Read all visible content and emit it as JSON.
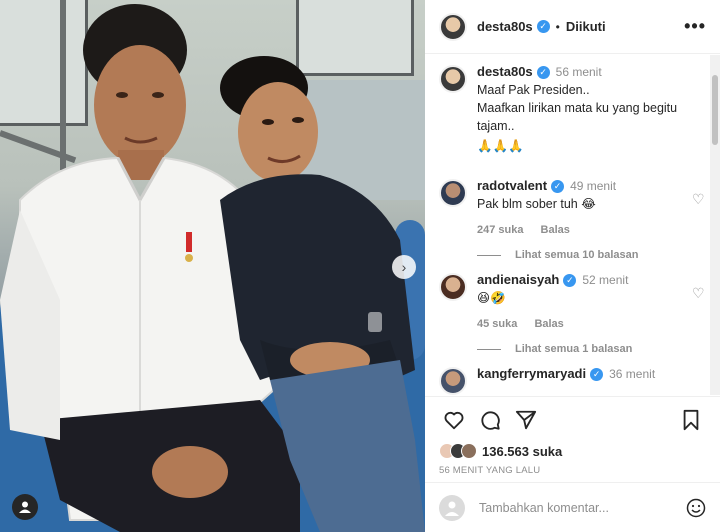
{
  "post": {
    "username": "desta80s",
    "follow_status": "Diikuti",
    "separator": "•",
    "more_label": "•••",
    "caption": {
      "username": "desta80s",
      "time": "56 menit",
      "lines": [
        "Maaf Pak Presiden..",
        "Maafkan lirikan mata ku yang begitu tajam..",
        "🙏🙏🙏"
      ]
    }
  },
  "comments": [
    {
      "username": "radotvalent",
      "time": "49 menit",
      "text": "Pak blm sober tuh 😂",
      "likes": "247 suka",
      "reply_label": "Balas",
      "view_replies": "Lihat semua 10 balasan"
    },
    {
      "username": "andienaisyah",
      "time": "52 menit",
      "text": "😆🤣",
      "likes": "45 suka",
      "reply_label": "Balas",
      "view_replies": "Lihat semua 1 balasan"
    },
    {
      "username": "kangferrymaryadi",
      "time": "36 menit"
    }
  ],
  "footer": {
    "like_count": "136.563 suka",
    "posted_ago": "56 MENIT YANG LALU",
    "comment_placeholder": "Tambahkan komentar..."
  },
  "colors": {
    "verified": "#3897f0",
    "text": "#262626",
    "muted": "#8e8e8e",
    "seat": "#2f6aa6"
  },
  "icons": [
    "verified-icon",
    "more-icon",
    "heart-icon",
    "comment-icon",
    "share-icon",
    "bookmark-icon",
    "next-arrow-icon",
    "user-tag-icon",
    "emoji-icon"
  ]
}
